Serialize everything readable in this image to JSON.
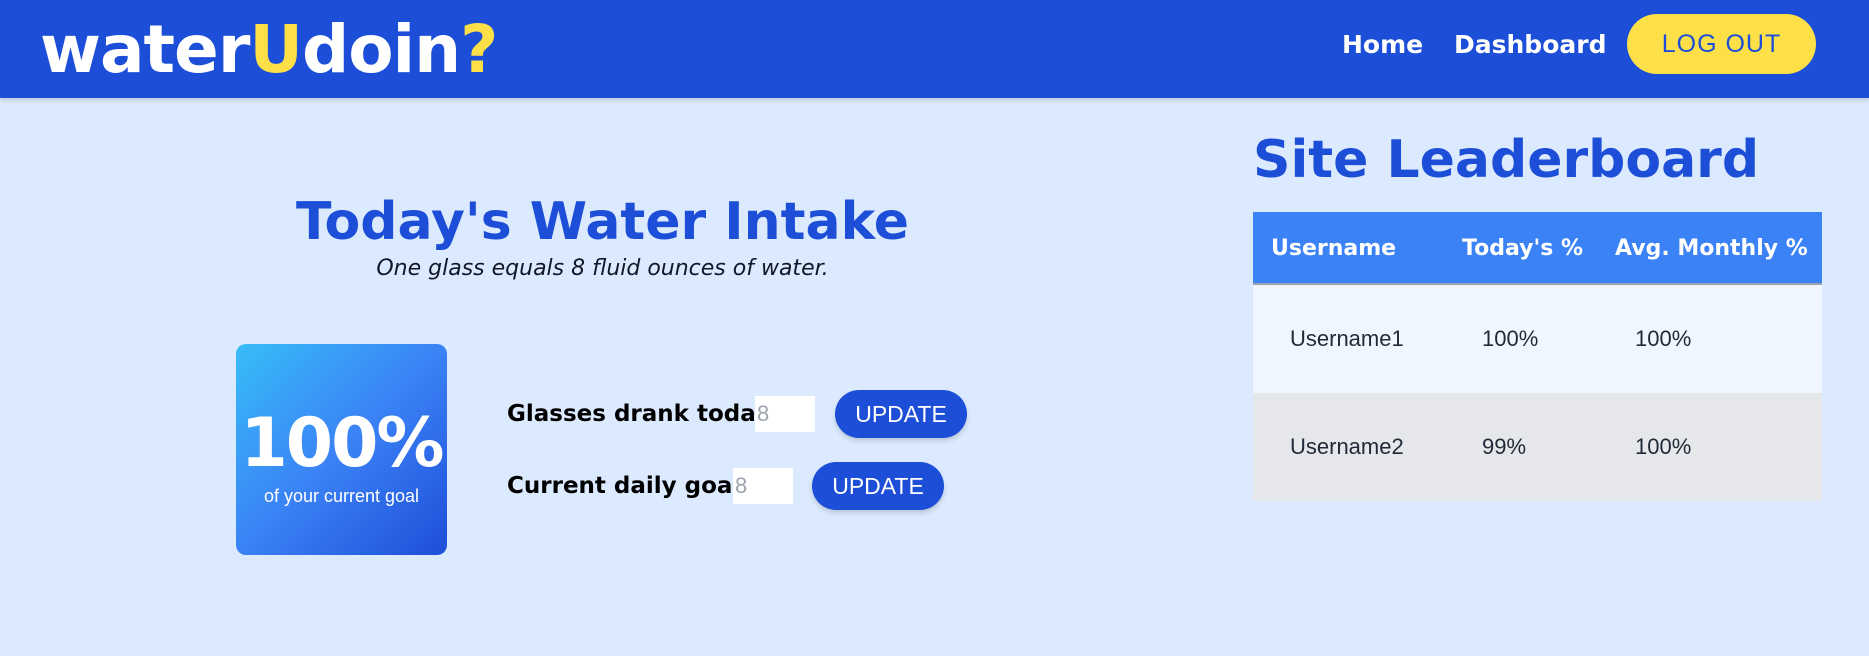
{
  "nav": {
    "logo_main": "water",
    "logo_u": "U",
    "logo_rest": "doin",
    "logo_q": "?",
    "home": "Home",
    "dashboard": "Dashboard",
    "logout": "LOG OUT"
  },
  "intake": {
    "title": "Today's Water Intake",
    "subtitle": "One glass equals 8 fluid ounces of water.",
    "progress_value": "100%",
    "progress_caption": "of your current goal",
    "glasses_label": "Glasses drank today:",
    "glasses_placeholder": "8",
    "goal_label": "Current daily goal:",
    "goal_placeholder": "8",
    "update_label": "UPDATE"
  },
  "leaderboard": {
    "title": "Site Leaderboard",
    "columns": [
      "Username",
      "Today's %",
      "Avg. Monthly %"
    ],
    "rows": [
      [
        "Username1",
        "100%",
        "100%"
      ],
      [
        "Username2",
        "99%",
        "100%"
      ]
    ]
  },
  "colors": {
    "brand_blue": "#1d4ed8",
    "accent_yellow": "#fde047",
    "page_bg": "#dbeafe",
    "header_row": "#3b82f6"
  }
}
